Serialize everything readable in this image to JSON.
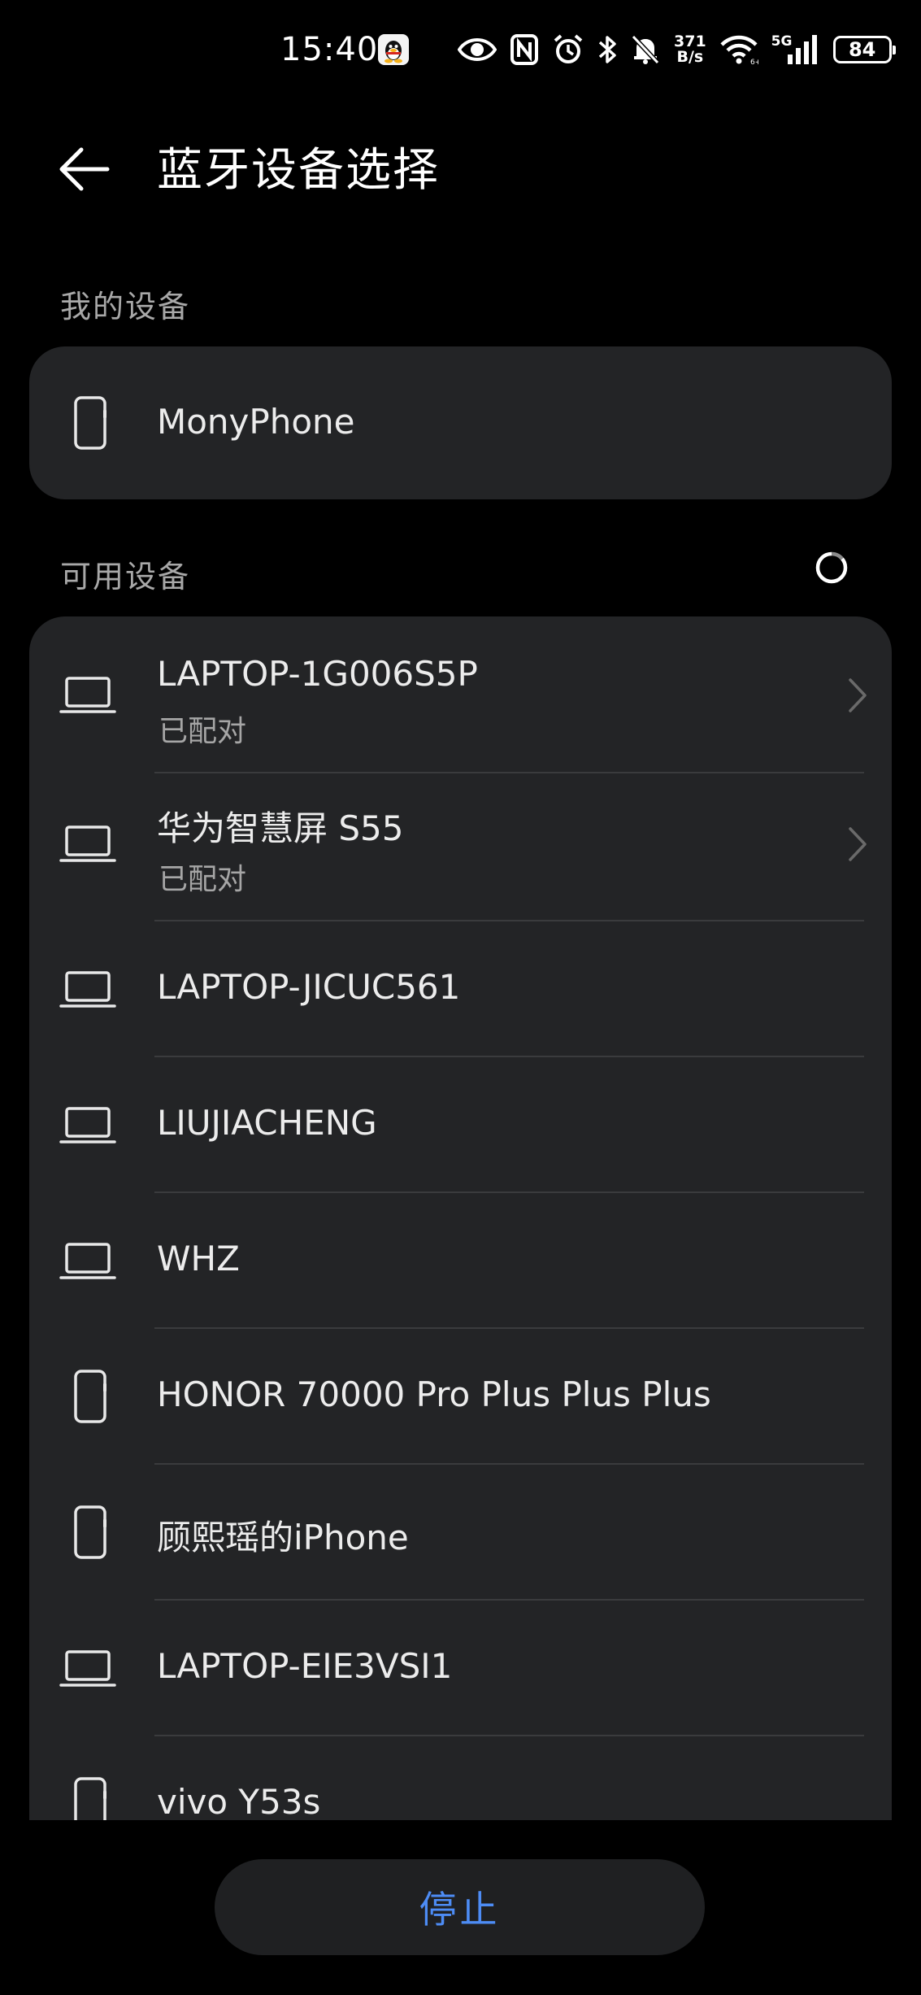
{
  "status_bar": {
    "time": "15:40",
    "net_speed_value": "371",
    "net_speed_unit": "B/s",
    "network_type": "5G",
    "battery": "84",
    "icons": [
      "qq-app-icon",
      "eye-icon",
      "nfc-icon",
      "alarm-icon",
      "bluetooth-icon",
      "bell-off-icon",
      "wifi-icon",
      "signal-icon",
      "battery-icon"
    ]
  },
  "header": {
    "back_icon": "arrow-left-icon",
    "title": "蓝牙设备选择"
  },
  "my_devices": {
    "label": "我的设备",
    "items": [
      {
        "name": "MonyPhone",
        "icon": "phone-icon"
      }
    ]
  },
  "available_devices": {
    "label": "可用设备",
    "status_icon": "loading-spinner-icon",
    "items": [
      {
        "name": "LAPTOP-1G006S5P",
        "status": "已配对",
        "icon": "laptop-icon",
        "has_chevron": true
      },
      {
        "name": "华为智慧屏 S55",
        "status": "已配对",
        "icon": "laptop-icon",
        "has_chevron": true
      },
      {
        "name": "LAPTOP-JICUC561",
        "icon": "laptop-icon"
      },
      {
        "name": "LIUJIACHENG",
        "icon": "laptop-icon"
      },
      {
        "name": "WHZ",
        "icon": "laptop-icon"
      },
      {
        "name": "HONOR 70000 Pro Plus Plus Plus",
        "icon": "phone-icon"
      },
      {
        "name": "顾熙瑶的iPhone",
        "icon": "phone-icon"
      },
      {
        "name": "LAPTOP-EIE3VSI1",
        "icon": "laptop-icon"
      },
      {
        "name": "vivo Y53s",
        "icon": "phone-icon"
      }
    ]
  },
  "footer": {
    "stop_label": "停止"
  },
  "colors": {
    "background": "#000000",
    "card": "#232426",
    "accent": "#4d8cf5",
    "secondary_text": "#a6a6a6"
  }
}
